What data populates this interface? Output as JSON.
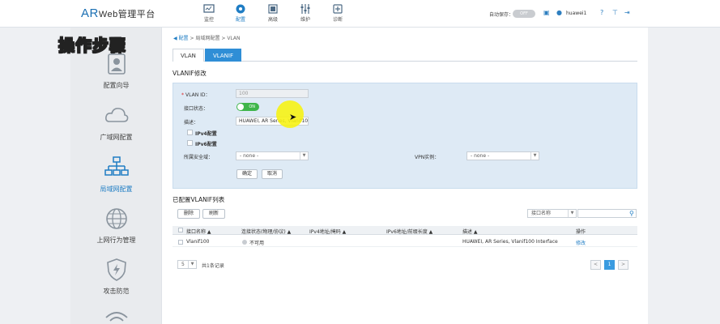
{
  "app": {
    "logo_ar": "AR",
    "logo_web": "Web管理平台"
  },
  "nav": [
    {
      "label": "监控",
      "icon": "monitor-icon"
    },
    {
      "label": "配置",
      "icon": "gear-icon"
    },
    {
      "label": "高级",
      "icon": "advanced-icon"
    },
    {
      "label": "维护",
      "icon": "maintenance-icon"
    },
    {
      "label": "诊断",
      "icon": "diagnose-icon"
    }
  ],
  "header": {
    "autosave_label": "自动保存：",
    "autosave_state": "OFF",
    "username": "huawei1"
  },
  "overlay": {
    "title": "操作步骤"
  },
  "sidebar": {
    "items": [
      {
        "label": "配置向导",
        "icon": "wizard-icon"
      },
      {
        "label": "广域网配置",
        "icon": "cloud-icon"
      },
      {
        "label": "局域网配置",
        "icon": "lan-icon"
      },
      {
        "label": "上网行为管理",
        "icon": "globe-icon"
      },
      {
        "label": "攻击防范",
        "icon": "shield-icon"
      }
    ]
  },
  "breadcrumb": {
    "home": "配置",
    "sep1": ">",
    "level2": "局域网配置",
    "sep2": ">",
    "level3": "VLAN"
  },
  "tabs": [
    {
      "label": "VLAN"
    },
    {
      "label": "VLANIF"
    }
  ],
  "form": {
    "section_title": "VLANIF修改",
    "vlan_id_label": "VLAN ID：",
    "vlan_id_value": "100",
    "port_state_label": "接口状态：",
    "port_state_value": "ON",
    "desc_label": "描述：",
    "desc_value": "HUAWEI, AR Series, Vlanif100",
    "ipv4_label": "IPv4配置",
    "ipv6_label": "IPv6配置",
    "zone_label": "所属安全域：",
    "zone_value": "- none -",
    "vpn_label": "VPN实例：",
    "vpn_value": "- none -",
    "ok_label": "确定",
    "cancel_label": "取消"
  },
  "list": {
    "section_title": "已配置VLANIF列表",
    "delete_label": "删除",
    "refresh_label": "刷新",
    "search_field": "接口名称",
    "columns": [
      "接口名称 ▲",
      "连接状态(物理/协议) ▲",
      "IPv4地址/掩码 ▲",
      "IPv6地址/前缀长度 ▲",
      "描述 ▲",
      "操作"
    ],
    "rows": [
      {
        "name": "Vlanif100",
        "status": "不可用",
        "ipv4": "",
        "ipv6": "",
        "desc": "HUAWEI, AR Series, Vlanif100 Interface",
        "action": "修改"
      }
    ],
    "page_size": "5",
    "total": "共1条记录",
    "prev": "<",
    "current_page": "1",
    "next": ">"
  }
}
